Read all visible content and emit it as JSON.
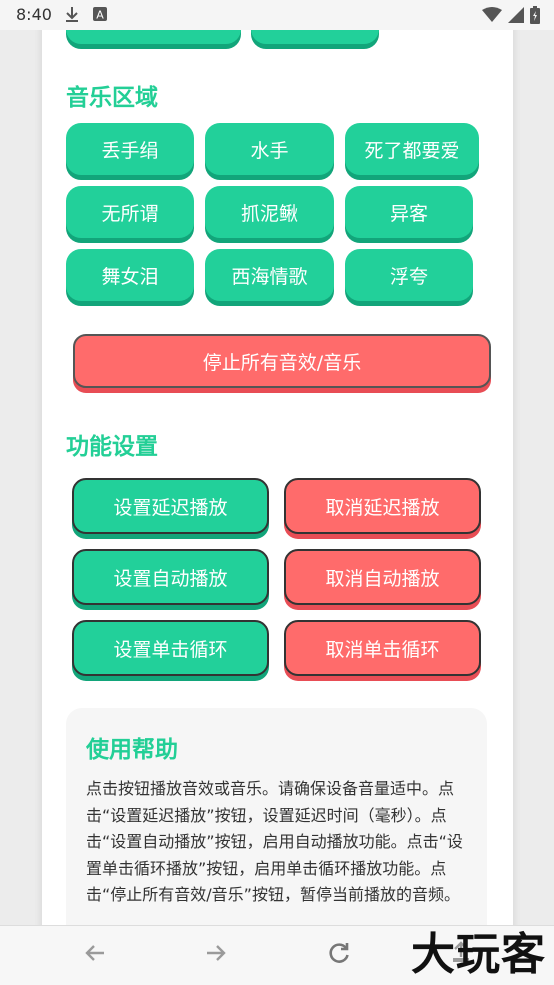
{
  "status_bar": {
    "time": "8:40",
    "icons": [
      "download-icon",
      "a-badge-icon",
      "wifi-icon",
      "signal-icon",
      "battery-icon"
    ]
  },
  "music_section": {
    "title": "音乐区域",
    "buttons": [
      "丢手绢",
      "水手",
      "死了都要爱",
      "无所谓",
      "抓泥鳅",
      "异客",
      "舞女泪",
      "西海情歌",
      "浮夸"
    ]
  },
  "stop_all_label": "停止所有音效/音乐",
  "settings_section": {
    "title": "功能设置",
    "buttons": [
      {
        "set": "设置延迟播放",
        "cancel": "取消延迟播放"
      },
      {
        "set": "设置自动播放",
        "cancel": "取消自动播放"
      },
      {
        "set": "设置单击循环",
        "cancel": "取消单击循环"
      }
    ]
  },
  "help": {
    "title": "使用帮助",
    "text": "点击按钮播放音效或音乐。请确保设备音量适中。点击“设置延迟播放”按钮，设置延迟时间（毫秒）。点击“设置自动播放”按钮，启用自动播放功能。点击“设置单击循环播放”按钮，启用单击循环播放功能。点击“停止所有音效/音乐”按钮，暂停当前播放的音频。"
  },
  "nav": {
    "icons": [
      "back-arrow-icon",
      "forward-arrow-icon",
      "reload-icon",
      "share-icon"
    ]
  },
  "watermark": "大玩客",
  "colors": {
    "accent_green": "#22d09a",
    "accent_red": "#ff6b6b",
    "title_green": "#23cf96"
  }
}
